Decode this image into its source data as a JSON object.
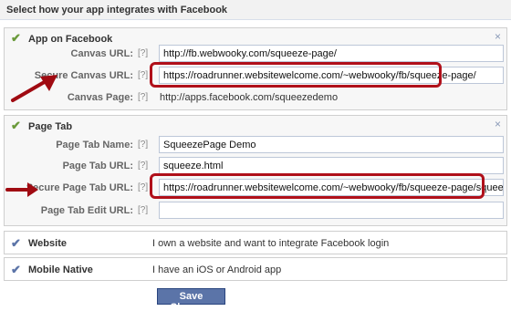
{
  "header": {
    "title": "Select how your app integrates with Facebook"
  },
  "app_on_facebook": {
    "title": "App on Facebook",
    "canvas_url": {
      "label": "Canvas URL:",
      "help": "[?]",
      "value": "http://fb.webwooky.com/squeeze-page/"
    },
    "secure_canvas_url": {
      "label": "Secure Canvas URL:",
      "help": "[?]",
      "value": "https://roadrunner.websitewelcome.com/~webwooky/fb/squeeze-page/"
    },
    "canvas_page": {
      "label": "Canvas Page:",
      "help": "[?]",
      "value": "http://apps.facebook.com/squeezedemo"
    }
  },
  "page_tab": {
    "title": "Page Tab",
    "name": {
      "label": "Page Tab Name:",
      "help": "[?]",
      "value": "SqueezePage Demo"
    },
    "url": {
      "label": "Page Tab URL:",
      "help": "[?]",
      "value": "squeeze.html"
    },
    "secure_url": {
      "label": "Secure Page Tab URL:",
      "help": "[?]",
      "value": "https://roadrunner.websitewelcome.com/~webwooky/fb/squeeze-page/squeeze.html"
    },
    "edit_url": {
      "label": "Page Tab Edit URL:",
      "help": "[?]",
      "value": ""
    }
  },
  "website": {
    "title": "Website",
    "description": "I own a website and want to integrate Facebook login"
  },
  "mobile_native": {
    "title": "Mobile Native",
    "description": "I have an iOS or Android app"
  },
  "save_button": "Save Changes",
  "icons": {
    "check": "✔",
    "close": "×"
  },
  "colors": {
    "highlight": "#b0101a",
    "button": "#5b74a8",
    "check_green": "#6a9a3a"
  }
}
